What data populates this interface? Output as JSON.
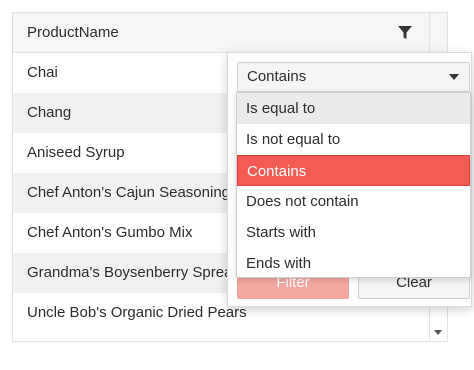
{
  "grid": {
    "column_header": "ProductName",
    "rows": [
      "Chai",
      "Chang",
      "Aniseed Syrup",
      "Chef Anton's Cajun Seasoning",
      "Chef Anton's Gumbo Mix",
      "Grandma's Boysenberry Spread",
      "Uncle Bob's Organic Dried Pears"
    ]
  },
  "filter_menu": {
    "operator_selected": "Contains",
    "filter_label": "Filter",
    "clear_label": "Clear",
    "operators": [
      "Is equal to",
      "Is not equal to",
      "Contains",
      "Does not contain",
      "Starts with",
      "Ends with"
    ],
    "highlighted_operator": "Contains",
    "hovered_operator": "Is equal to"
  },
  "colors": {
    "accent": "#f35b54",
    "accent_disabled": "#f4a6a1",
    "header_bg": "#f6f6f6",
    "alt_row_bg": "#f1f1f1"
  },
  "icons": {
    "header_filter": "filter-icon",
    "select_arrow": "chevron-down-icon",
    "scroll_down": "scroll-down-arrow-icon"
  }
}
